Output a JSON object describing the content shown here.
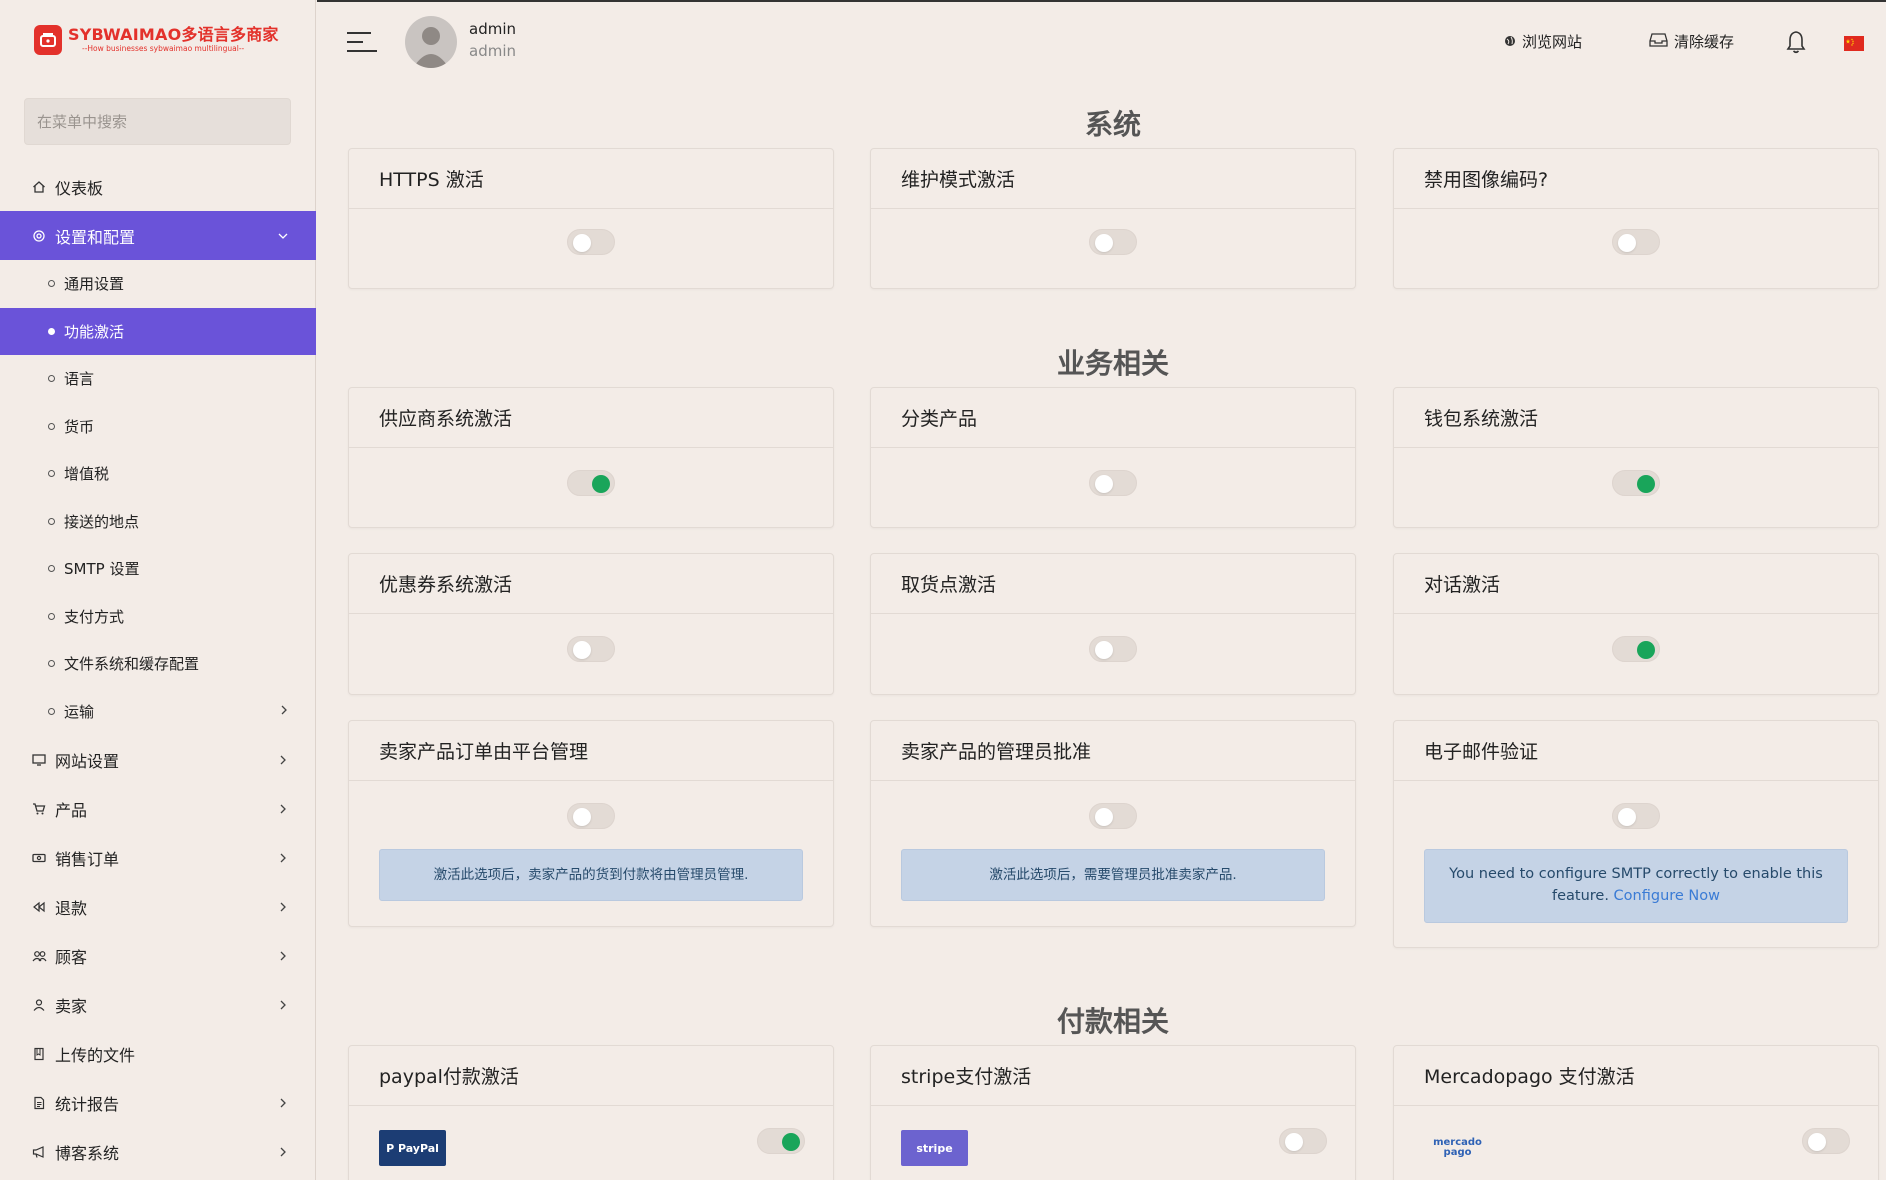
{
  "brand": {
    "title": "SYBWAIMAO多语言多商家",
    "subtitle": "--How businesses sybwaimao multilingual--",
    "accent": "#6a53d9",
    "logo_red": "#e3312b"
  },
  "sidebar": {
    "search_placeholder": "在菜单中搜索",
    "items": [
      {
        "label": "仪表板",
        "icon": "home-icon"
      },
      {
        "label": "设置和配置",
        "icon": "gear-icon"
      },
      {
        "label": "网站设置",
        "icon": "monitor-icon"
      },
      {
        "label": "产品",
        "icon": "cart-icon"
      },
      {
        "label": "销售订单",
        "icon": "money-icon"
      },
      {
        "label": "退款",
        "icon": "backward-icon"
      },
      {
        "label": "顾客",
        "icon": "users-icon"
      },
      {
        "label": "卖家",
        "icon": "user-icon"
      },
      {
        "label": "上传的文件",
        "icon": "folder-icon"
      },
      {
        "label": "统计报告",
        "icon": "file-icon"
      },
      {
        "label": "博客系统",
        "icon": "megaphone-icon"
      }
    ],
    "subitems": [
      "通用设置",
      "功能激活",
      "语言",
      "货币",
      "增值税",
      "接送的地点",
      "SMTP 设置",
      "支付方式",
      "文件系统和缓存配置",
      "运输"
    ]
  },
  "header": {
    "user_name": "admin",
    "user_role": "admin",
    "browse_site": "浏览网站",
    "clear_cache": "清除缓存"
  },
  "sections": {
    "system": "系统",
    "business": "业务相关",
    "payment": "付款相关"
  },
  "cards": {
    "https": {
      "title": "HTTPS 激活",
      "enabled": false
    },
    "maintenance": {
      "title": "维护模式激活",
      "enabled": false
    },
    "image_encoding": {
      "title": "禁用图像编码?",
      "enabled": false
    },
    "vendor": {
      "title": "供应商系统激活",
      "enabled": true
    },
    "category": {
      "title": "分类产品",
      "enabled": false
    },
    "wallet": {
      "title": "钱包系统激活",
      "enabled": true
    },
    "coupon": {
      "title": "优惠券系统激活",
      "enabled": false
    },
    "pickup": {
      "title": "取货点激活",
      "enabled": false
    },
    "conversation": {
      "title": "对话激活",
      "enabled": true
    },
    "seller_orders": {
      "title": "卖家产品订单由平台管理",
      "enabled": false,
      "note": "激活此选项后，卖家产品的货到付款将由管理员管理."
    },
    "seller_approval": {
      "title": "卖家产品的管理员批准",
      "enabled": false,
      "note": "激活此选项后，需要管理员批准卖家产品."
    },
    "email_verify": {
      "title": "电子邮件验证",
      "enabled": false,
      "note": "You need to configure SMTP correctly to enable this feature.",
      "link": "Configure Now"
    },
    "paypal": {
      "title": "paypal付款激活",
      "enabled": true,
      "logo": "P PayPal"
    },
    "stripe": {
      "title": "stripe支付激活",
      "enabled": false,
      "logo": "stripe"
    },
    "mercadopago": {
      "title": "Mercadopago 支付激活",
      "enabled": false,
      "logo": "mercado pago"
    }
  }
}
